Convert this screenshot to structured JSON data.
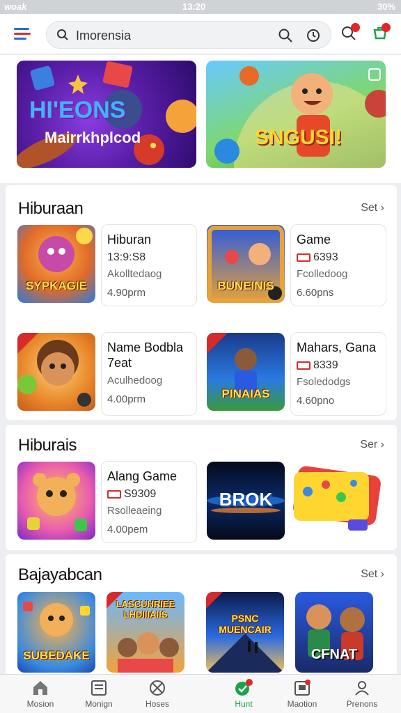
{
  "status_bar": {
    "left": "woak",
    "time": "13:20",
    "battery": "30%"
  },
  "search": {
    "value": "Imorensia",
    "placeholder": ""
  },
  "top_icons": {
    "notifications_badge": "",
    "cart_badge": ""
  },
  "banners": [
    {
      "title": "HI'EONS",
      "subtitle": "Mairrkhplcod"
    },
    {
      "title": "SNGUSI!"
    }
  ],
  "sections": [
    {
      "title": "Hiburaan",
      "more": "Set",
      "items": [
        {
          "thumb_text": "SYPKAGIE",
          "name": "Hiburan",
          "sub": "13:9:S8",
          "desc": "Akolltedaog",
          "time": "4.90prm"
        },
        {
          "thumb_text": "BUNEINIS",
          "name": "Game",
          "sub": "6393",
          "desc": "Fcolledoog",
          "time": "6.60pns"
        },
        {
          "thumb_text": "",
          "name": "Name Bodbla 7eat",
          "sub": "",
          "desc": "Aculhedoog",
          "time": "4.00prm"
        },
        {
          "thumb_text": "PINAIAS",
          "name": "Mahars, Gana",
          "sub": "8339",
          "desc": "Fsoledodgs",
          "time": "4.60pno"
        }
      ]
    },
    {
      "title": "Hiburais",
      "more": "Ser",
      "items": [
        {
          "thumb_text": "",
          "name": "Alang Game",
          "sub": "S9309",
          "desc": "Rsolleaeing",
          "time": "4.00pem"
        },
        {
          "thumb_text": "BROK"
        },
        {
          "thumb_text": ""
        }
      ]
    },
    {
      "title": "Bajayabcan",
      "more": "Set",
      "items": [
        {
          "thumb_text": "SUBEDAKE"
        },
        {
          "thumb_text": "LASCUHRIEE LHDIIIAIIS"
        },
        {
          "thumb_text": "PSNC MUENCAIR"
        },
        {
          "thumb_text": "CFNAT"
        }
      ]
    }
  ],
  "bottom_nav": [
    {
      "label": "Mosion"
    },
    {
      "label": "Monign"
    },
    {
      "label": "Hoses"
    },
    {
      "label": "Hunt"
    },
    {
      "label": "Maotion"
    },
    {
      "label": "Prenons"
    }
  ],
  "colors": {
    "accent": "#1aa34a",
    "badge": "#e32727",
    "menu": "#2a6ad8"
  }
}
